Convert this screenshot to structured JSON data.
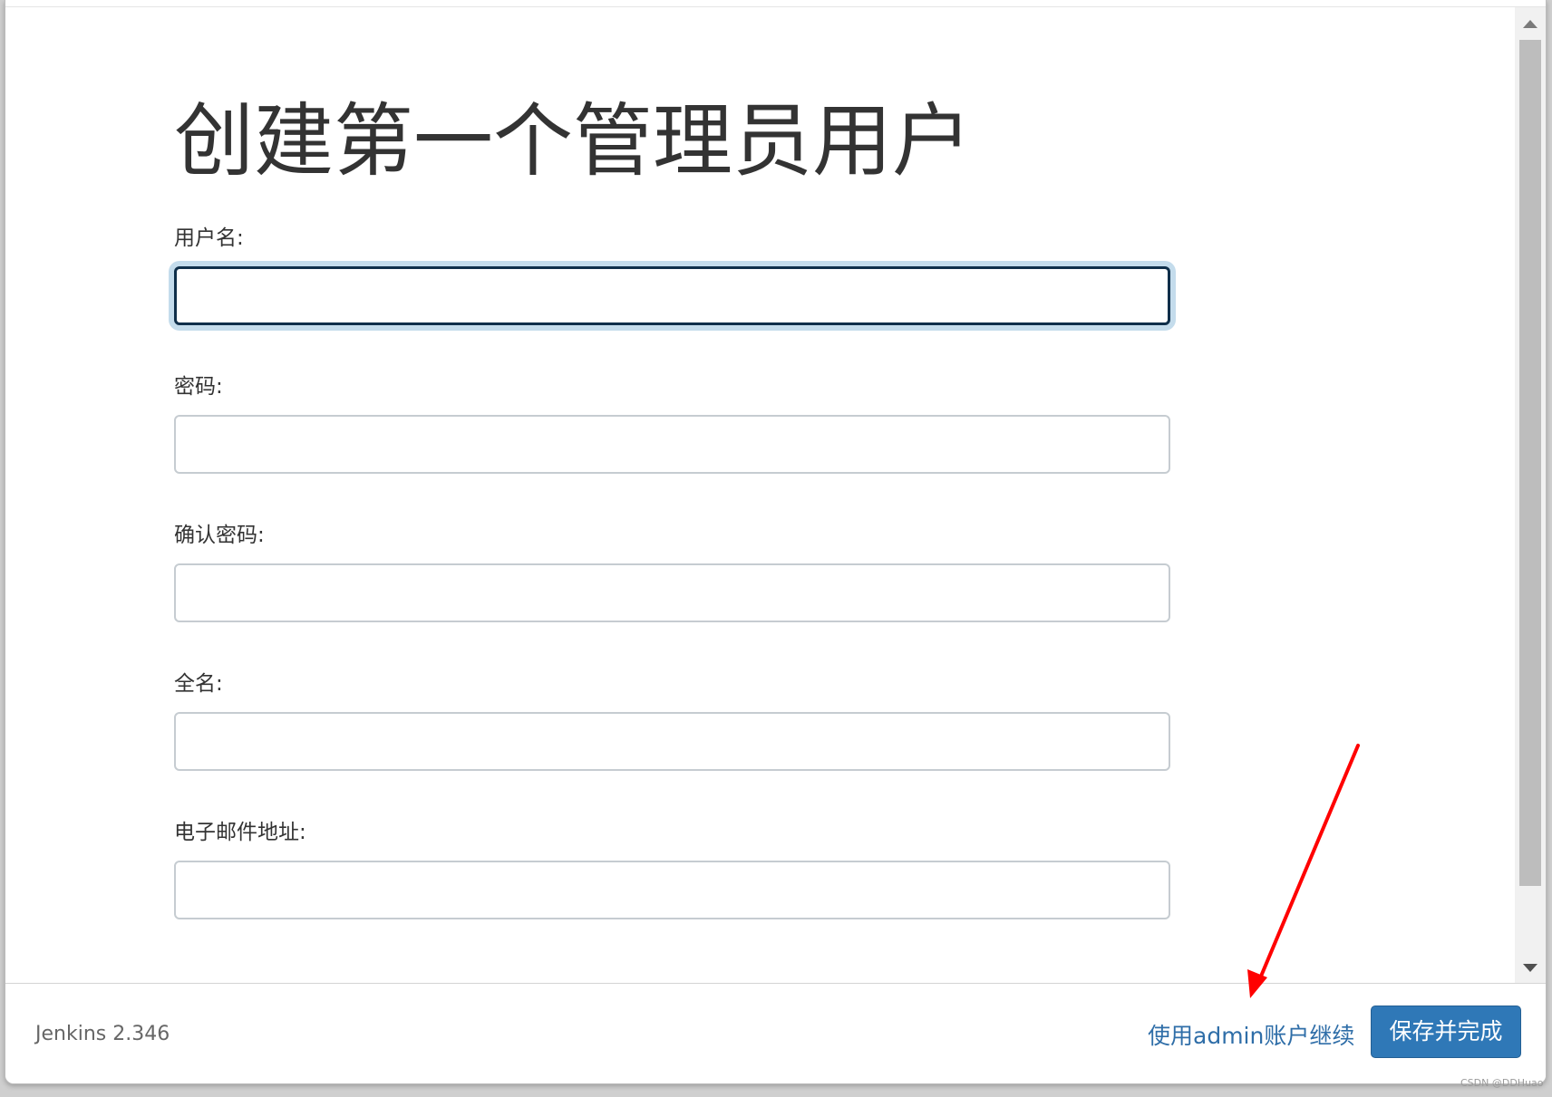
{
  "page": {
    "title": "创建第一个管理员用户"
  },
  "form": {
    "fields": [
      {
        "label": "用户名:",
        "value": "",
        "focused": true
      },
      {
        "label": "密码:",
        "value": ""
      },
      {
        "label": "确认密码:",
        "value": ""
      },
      {
        "label": "全名:",
        "value": ""
      },
      {
        "label": "电子邮件地址:",
        "value": ""
      }
    ]
  },
  "footer": {
    "version": "Jenkins 2.346",
    "continue_as_admin_label": "使用admin账户继续",
    "save_finish_label": "保存并完成"
  },
  "watermark": "CSDN @DDHuao",
  "colors": {
    "link": "#2f6ea8",
    "primary_button": "#2f78b7",
    "focus_border": "#0f2f4a",
    "focus_ring": "#c4dcec",
    "annotation_arrow": "#ff0000"
  }
}
